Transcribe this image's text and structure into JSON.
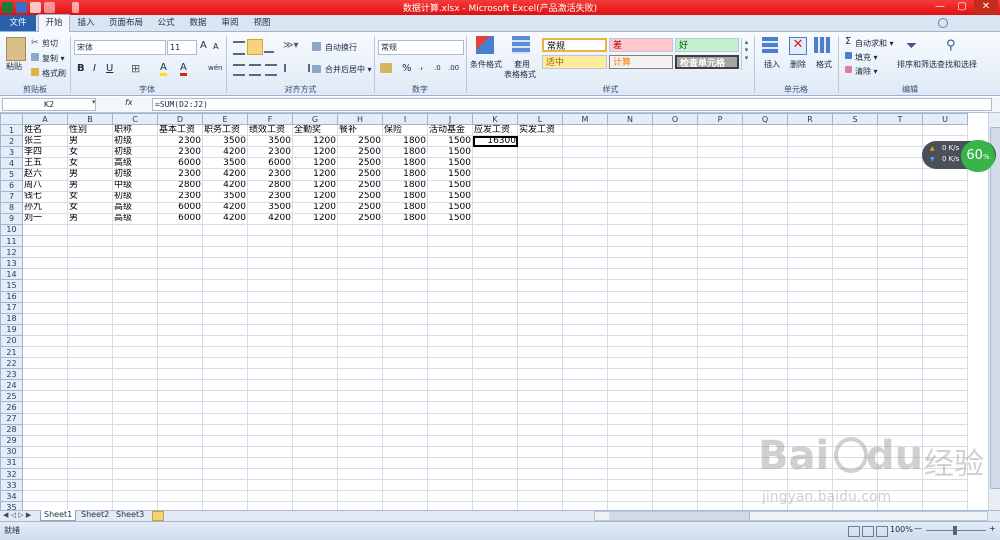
{
  "window": {
    "title": "数据计算.xlsx  -  Microsoft Excel(产品激活失败)",
    "minimize": "—",
    "maximize": "▢",
    "close": "✕"
  },
  "tabs": [
    "文件",
    "开始",
    "插入",
    "页面布局",
    "公式",
    "数据",
    "审阅",
    "视图"
  ],
  "ribbon": {
    "clipboard": {
      "paste": "粘贴",
      "cut": "剪切",
      "copy": "复制 ▾",
      "format_painter": "格式刷",
      "label": "剪贴板"
    },
    "font": {
      "name": "宋体",
      "size": "11",
      "grow": "A",
      "shrink": "A",
      "bold": "B",
      "italic": "I",
      "underline": "U",
      "border": "⊞",
      "fill": "A",
      "color": "A",
      "phonetic": "wén",
      "label": "字体"
    },
    "alignment": {
      "wrap": "自动换行",
      "merge": "合并后居中 ▾",
      "label": "对齐方式"
    },
    "number": {
      "format": "常规",
      "percent": "%",
      "comma": ",",
      "label": "数字"
    },
    "styles": {
      "conditional": "条件格式",
      "table_format_1": "套用",
      "table_format_2": "表格格式",
      "cells": [
        "常规",
        "差",
        "好",
        "适中",
        "计算",
        "检查单元格"
      ],
      "label": "样式"
    },
    "cells": {
      "insert": "插入",
      "delete": "删除",
      "format": "格式",
      "label": "单元格"
    },
    "editing": {
      "autosum": "自动求和 ▾",
      "fill": "填充 ▾",
      "clear": "清除 ▾",
      "sort": "排序和筛选",
      "find": "查找和选择",
      "label": "编辑"
    }
  },
  "formula_bar": {
    "name_box": "K2",
    "fx": "fx",
    "formula": "=SUM(D2:J2)"
  },
  "sheet": {
    "columns": [
      "A",
      "B",
      "C",
      "D",
      "E",
      "F",
      "G",
      "H",
      "I",
      "J",
      "K",
      "L",
      "M",
      "N",
      "O",
      "P",
      "Q",
      "R",
      "S",
      "T",
      "U"
    ],
    "selected_column": "K",
    "header_row": [
      "姓名",
      "性别",
      "职称",
      "基本工资",
      "职务工资",
      "绩效工资",
      "全勤奖",
      "餐补",
      "保险",
      "活动基金",
      "应发工资",
      "实发工资"
    ],
    "rows": [
      [
        "张三",
        "男",
        "初级",
        "2300",
        "3500",
        "3500",
        "1200",
        "2500",
        "1800",
        "1500",
        "16300"
      ],
      [
        "李四",
        "女",
        "初级",
        "2300",
        "4200",
        "2300",
        "1200",
        "2500",
        "1800",
        "1500",
        ""
      ],
      [
        "王五",
        "女",
        "高级",
        "6000",
        "3500",
        "6000",
        "1200",
        "2500",
        "1800",
        "1500",
        ""
      ],
      [
        "赵六",
        "男",
        "初级",
        "2300",
        "4200",
        "2300",
        "1200",
        "2500",
        "1800",
        "1500",
        ""
      ],
      [
        "周八",
        "男",
        "中级",
        "2800",
        "4200",
        "2800",
        "1200",
        "2500",
        "1800",
        "1500",
        ""
      ],
      [
        "钱七",
        "女",
        "初级",
        "2300",
        "3500",
        "2300",
        "1200",
        "2500",
        "1800",
        "1500",
        ""
      ],
      [
        "孙九",
        "女",
        "高级",
        "6000",
        "4200",
        "3500",
        "1200",
        "2500",
        "1800",
        "1500",
        ""
      ],
      [
        "刘一",
        "男",
        "高级",
        "6000",
        "4200",
        "4200",
        "1200",
        "2500",
        "1800",
        "1500",
        ""
      ]
    ],
    "row_numbers": [
      "1",
      "2",
      "3",
      "4",
      "5",
      "6",
      "7",
      "8",
      "9",
      "10",
      "11",
      "12",
      "13",
      "14",
      "15",
      "16",
      "17",
      "18",
      "19",
      "20",
      "21",
      "22",
      "23",
      "24",
      "25",
      "26",
      "27",
      "28",
      "29",
      "30",
      "31",
      "32",
      "33",
      "34",
      "35"
    ]
  },
  "sheet_tabs": [
    "Sheet1",
    "Sheet2",
    "Sheet3"
  ],
  "status": {
    "ready": "就绪",
    "zoom": "100%",
    "zoom_minus": "—",
    "zoom_plus": "+"
  },
  "net_widget": {
    "up": "0 K/s",
    "down": "0 K/s",
    "percent": "60",
    "percent_sign": "%"
  },
  "watermark": {
    "brand": "Bai",
    "brand2": "du",
    "cn": "经验",
    "url": "jingyan.baidu.com"
  }
}
